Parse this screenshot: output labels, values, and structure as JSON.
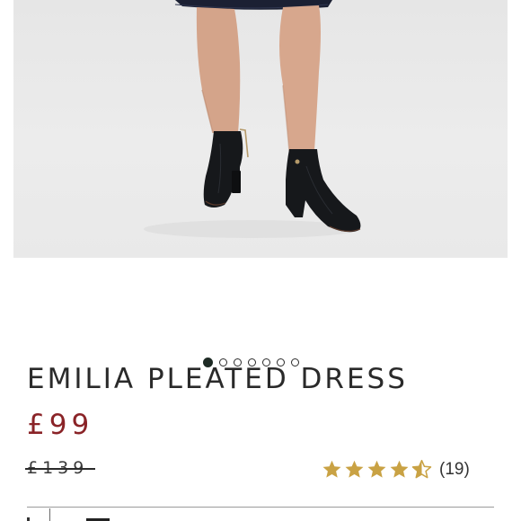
{
  "product": {
    "image_alt": "Model wearing dress with black ankle boots",
    "title": "EMILIA PLEATED DRESS",
    "price_current": "£99",
    "price_original": "£139"
  },
  "carousel": {
    "total": 7,
    "active_index": 0
  },
  "rating": {
    "stars": 4.5,
    "max": 5,
    "count_label": "(19)"
  },
  "colors": {
    "price_sale": "#8a2327",
    "star_fill": "#c9a244",
    "dot_active": "#1e2b25",
    "text": "#2a2a2a"
  }
}
